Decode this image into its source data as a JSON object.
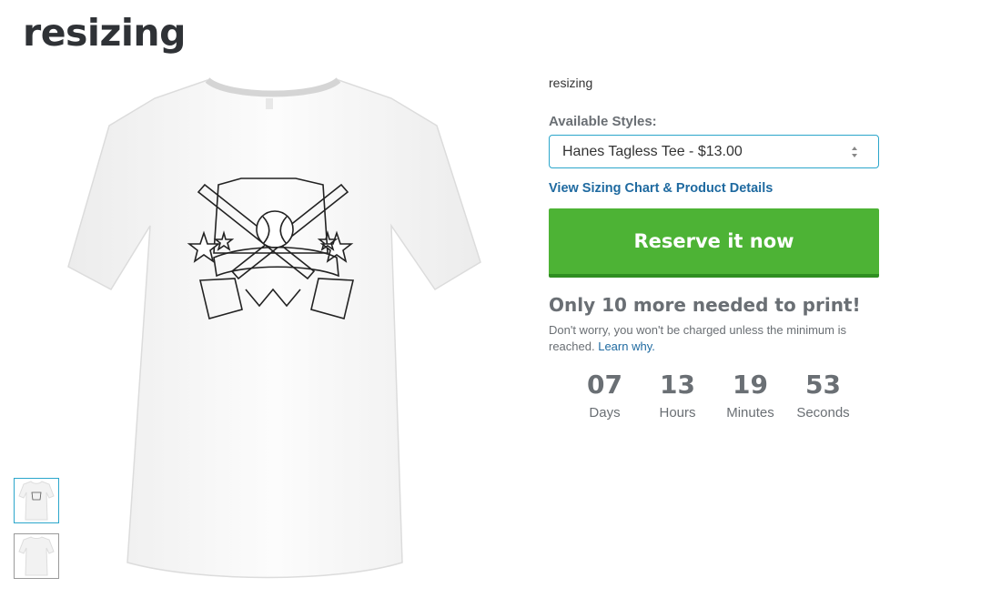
{
  "page": {
    "title": "resizing"
  },
  "product": {
    "subtitle": "resizing",
    "styles_label": "Available Styles:",
    "selected_style": "Hanes Tagless Tee - $13.00",
    "sizing_link": "View Sizing Chart & Product Details",
    "reserve_button": "Reserve it now",
    "needed_text": "Only 10 more needed to print!",
    "note_text": "Don't worry, you won't be charged unless the minimum is reached.",
    "note_link": "Learn why."
  },
  "countdown": [
    {
      "value": "07",
      "label": "Days"
    },
    {
      "value": "13",
      "label": "Hours"
    },
    {
      "value": "19",
      "label": "Minutes"
    },
    {
      "value": "53",
      "label": "Seconds"
    }
  ],
  "thumbnails": [
    {
      "name": "front",
      "active": true
    },
    {
      "name": "back",
      "active": false
    }
  ],
  "colors": {
    "accent_blue": "#2ba6cb",
    "link_blue": "#1f6aa0",
    "button_green": "#4db335",
    "muted_gray": "#6a6f74"
  }
}
